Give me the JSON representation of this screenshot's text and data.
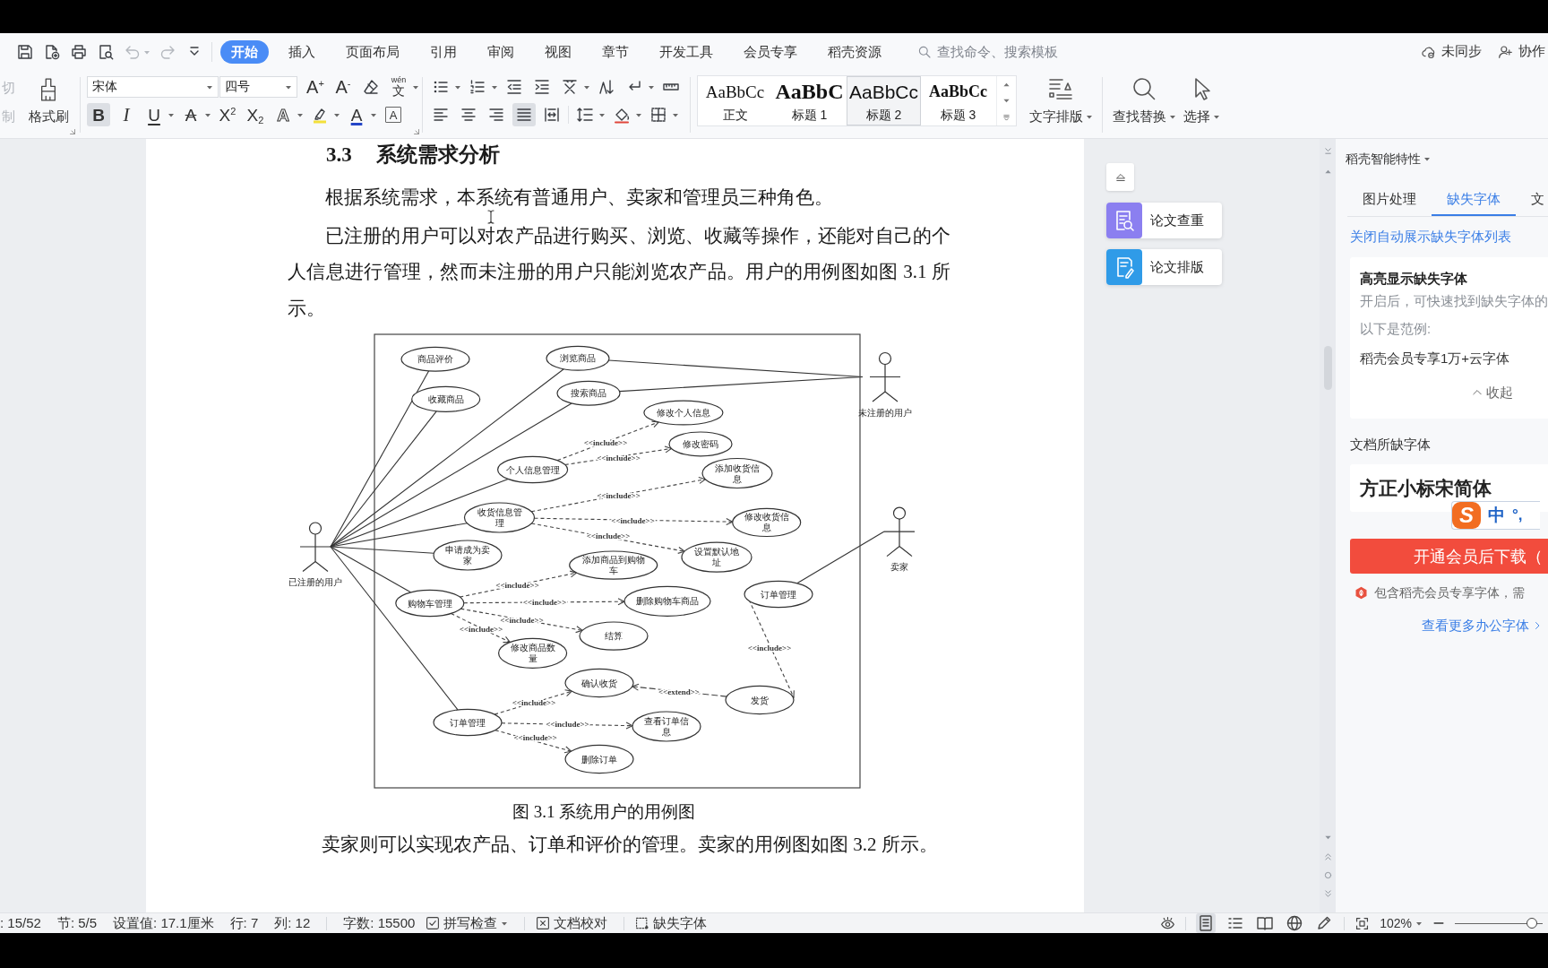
{
  "quick_access": [
    {
      "kind": "save",
      "disabled": false
    },
    {
      "kind": "export",
      "disabled": false
    },
    {
      "kind": "print",
      "disabled": false
    },
    {
      "kind": "preview",
      "disabled": false
    },
    {
      "kind": "undo",
      "disabled": true
    },
    {
      "kind": "redo",
      "disabled": true
    },
    {
      "kind": "customize",
      "disabled": false
    }
  ],
  "tabs": [
    {
      "label": "开始",
      "selected": true
    },
    {
      "label": "插入",
      "selected": false
    },
    {
      "label": "页面布局",
      "selected": false
    },
    {
      "label": "引用",
      "selected": false
    },
    {
      "label": "审阅",
      "selected": false
    },
    {
      "label": "视图",
      "selected": false
    },
    {
      "label": "章节",
      "selected": false
    },
    {
      "label": "开发工具",
      "selected": false
    },
    {
      "label": "会员专享",
      "selected": false
    },
    {
      "label": "稻壳资源",
      "selected": false
    }
  ],
  "search": {
    "placeholder": "查找命令、搜索模板"
  },
  "account": {
    "sync": "未同步",
    "collaborate": "协作"
  },
  "ribbon": {
    "clipboard": [
      {
        "label": "切",
        "disabled": true
      },
      {
        "label": "制",
        "disabled": true
      }
    ],
    "format_painter": "格式刷",
    "font_name": "宋体",
    "font_size": "四号",
    "font_row": [
      {
        "kind": "grow",
        "glyph": "A$^{+}$"
      },
      {
        "kind": "shrink",
        "glyph": "A$^{-}$"
      },
      {
        "kind": "eraser"
      },
      {
        "kind": "pinyin",
        "ruby": "wén",
        "glyph": "文"
      }
    ],
    "format_row": [
      {
        "kind": "bold",
        "glyph": "B",
        "selected": true
      },
      {
        "kind": "italic",
        "glyph": "I",
        "selected": false
      },
      {
        "kind": "underline",
        "glyph": "U",
        "selected": false
      },
      {
        "kind": "strike",
        "glyph": "A",
        "selected": false
      },
      {
        "kind": "superscript",
        "glyph": "X$^{2}$",
        "selected": false
      },
      {
        "kind": "subscript",
        "glyph": "X$_{2}$",
        "selected": false
      },
      {
        "kind": "effect",
        "glyph": "A",
        "selected": false
      },
      {
        "kind": "highlight",
        "selected": false
      },
      {
        "kind": "color",
        "glyph": "A",
        "selected": false
      },
      {
        "kind": "border",
        "glyph": "A",
        "selected": false
      }
    ],
    "alignment": [
      {
        "kind": "left",
        "selected": false
      },
      {
        "kind": "center",
        "selected": false
      },
      {
        "kind": "right",
        "selected": false
      },
      {
        "kind": "justify",
        "selected": true
      },
      {
        "kind": "distributed",
        "selected": false
      }
    ],
    "styles": [
      {
        "kind": "body",
        "sample": "AaBbCc",
        "name": "正文",
        "selected": false
      },
      {
        "kind": "heading1",
        "sample": "AaBbC",
        "name": "标题 1",
        "selected": false
      },
      {
        "kind": "heading2",
        "sample": "AaBbCc",
        "name": "标题 2",
        "selected": true
      },
      {
        "kind": "heading3",
        "sample": "AaBbCc",
        "name": "标题 3",
        "selected": false
      }
    ],
    "big_tools": [
      {
        "kind": "layout",
        "label": "文字排版"
      },
      {
        "kind": "find",
        "label": "查找替换"
      },
      {
        "kind": "select",
        "label": "选择"
      }
    ]
  },
  "document": {
    "heading_number": "3.3",
    "heading": "系统需求分析",
    "paragraphs": [
      "根据系统需求，本系统有普通用户、卖家和管理员三种角色。",
      "已注册的用户可以对农产品进行购买、浏览、收藏等操作，还能对自己的个人信息进行管理，然而未注册的用户只能浏览农产品。用户的用例图如图 3.1 所示。"
    ],
    "figure": {
      "actors": [
        {
          "label": "已注册的用户"
        },
        {
          "label": "未注册的用户"
        },
        {
          "label": "卖家"
        }
      ],
      "use_cases": [
        {
          "label": "商品评价"
        },
        {
          "label": "浏览商品"
        },
        {
          "label": "收藏商品"
        },
        {
          "label": "搜索商品"
        },
        {
          "label": "修改个人信息"
        },
        {
          "label": "修改密码"
        },
        {
          "label": "个人信息管理"
        },
        {
          "label": "添加收货信息"
        },
        {
          "label": "收货信息管理"
        },
        {
          "label": "修改收货信息"
        },
        {
          "label": "申请成为卖家"
        },
        {
          "label": "添加商品到购物车"
        },
        {
          "label": "设置默认地址"
        },
        {
          "label": "购物车管理"
        },
        {
          "label": "删除购物车商品"
        },
        {
          "label": "订单管理"
        },
        {
          "label": "结算"
        },
        {
          "label": "修改商品数量"
        },
        {
          "label": "确认收货"
        },
        {
          "label": "发货"
        },
        {
          "label": "订单管理"
        },
        {
          "label": "查看订单信息"
        },
        {
          "label": "删除订单"
        }
      ],
      "relations": [
        {
          "kind": "include",
          "label": "<<include>>"
        },
        {
          "kind": "include",
          "label": "<<include>>"
        },
        {
          "kind": "include",
          "label": "<<include>>"
        },
        {
          "kind": "include",
          "label": "<<include>>"
        },
        {
          "kind": "include",
          "label": "<<include>>"
        },
        {
          "kind": "include",
          "label": "<<include>>"
        },
        {
          "kind": "include",
          "label": "<<include>>"
        },
        {
          "kind": "include",
          "label": "<<include>>"
        },
        {
          "kind": "include",
          "label": "<<include>>"
        },
        {
          "kind": "include",
          "label": "<<include>>"
        },
        {
          "kind": "extend",
          "label": "<<extend>>"
        },
        {
          "kind": "include",
          "label": "<<include>>"
        },
        {
          "kind": "include",
          "label": "<<include>>"
        },
        {
          "kind": "include",
          "label": "<<include>>"
        }
      ]
    },
    "caption": "图 3.1 系统用户的用例图",
    "paragraphs_after": [
      "卖家则可以实现农产品、订单和评价的管理。卖家的用例图如图 3.2 所示。"
    ]
  },
  "side_tools": [
    {
      "kind": "check",
      "label": "论文查重"
    },
    {
      "kind": "layout",
      "label": "论文排版"
    }
  ],
  "panel": {
    "title": "稻壳智能特性",
    "tabs": [
      {
        "label": "图片处理",
        "selected": false
      },
      {
        "label": "缺失字体",
        "selected": true
      },
      {
        "label": "文",
        "selected": false
      }
    ],
    "link": "关闭自动展示缺失字体列表",
    "tip": {
      "title": "高亮显示缺失字体",
      "lines": [
        "开启后，可快速找到缺失字体的",
        "以下是范例:"
      ],
      "example": "稻壳会员专享1万+云字体",
      "collapse": "收起"
    },
    "missing_heading": "文档所缺字体",
    "fonts": [
      "方正小标宋简体"
    ],
    "download": "开通会员后下载（",
    "notice": "包含稻壳会员专享字体，需",
    "more": "查看更多办公字体"
  },
  "ime_bar": {
    "logo": "S",
    "mode": "中",
    "punct": "°,"
  },
  "status_bar": {
    "fields": [
      ": 15/52",
      "节: 5/5",
      "设置值: 17.1厘米",
      "行: 7",
      "列: 12"
    ],
    "word_count": "字数: 15500",
    "tools": [
      {
        "kind": "spell",
        "label": "拼写检查"
      },
      {
        "kind": "proof",
        "label": "文档校对"
      },
      {
        "kind": "font",
        "label": "缺失字体"
      }
    ],
    "views": [
      {
        "kind": "page",
        "selected": true
      },
      {
        "kind": "outline",
        "selected": false
      },
      {
        "kind": "read",
        "selected": false
      },
      {
        "kind": "web",
        "selected": false
      },
      {
        "kind": "write",
        "selected": false
      }
    ],
    "zoom": "102%",
    "zoom_slider": {
      "level": 0.88
    }
  }
}
